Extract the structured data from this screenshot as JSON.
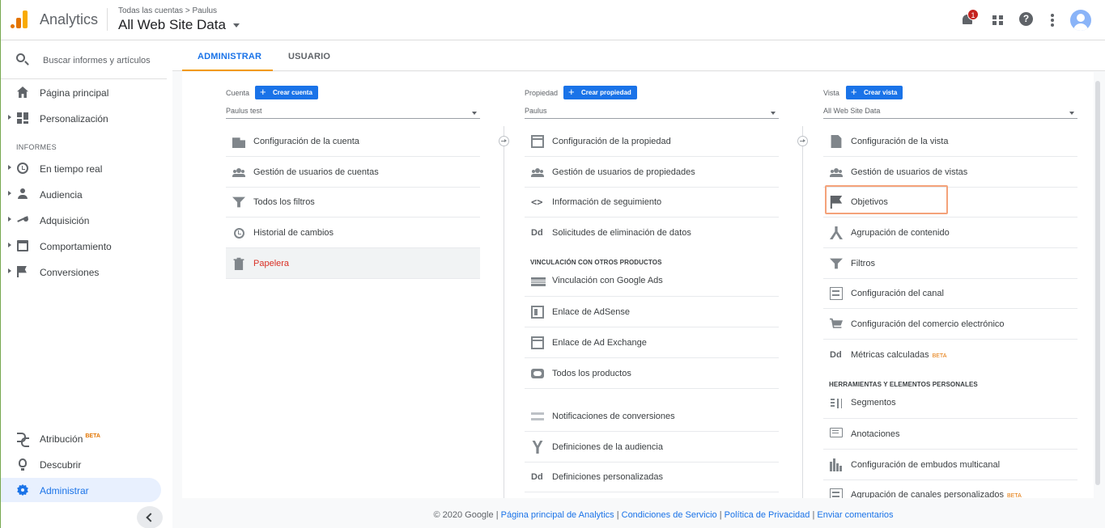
{
  "header": {
    "app_name": "Analytics",
    "breadcrumb": "Todas las cuentas > Paulus",
    "view_title": "All Web Site Data",
    "notification_count": "1"
  },
  "sidebar": {
    "search_placeholder": "Buscar informes y artículos",
    "home": "Página principal",
    "customization": "Personalización",
    "reports_label": "INFORMES",
    "reports": [
      "En tiempo real",
      "Audiencia",
      "Adquisición",
      "Comportamiento",
      "Conversiones"
    ],
    "attribution": "Atribución",
    "attribution_badge": "BETA",
    "discover": "Descubrir",
    "admin": "Administrar"
  },
  "tabs": {
    "admin": "ADMINISTRAR",
    "user": "USUARIO"
  },
  "account_col": {
    "label": "Cuenta",
    "create": "Crear cuenta",
    "selected": "Paulus test",
    "items": [
      "Configuración de la cuenta",
      "Gestión de usuarios de cuentas",
      "Todos los filtros",
      "Historial de cambios",
      "Papelera"
    ]
  },
  "property_col": {
    "label": "Propiedad",
    "create": "Crear propiedad",
    "selected": "Paulus",
    "items": [
      "Configuración de la propiedad",
      "Gestión de usuarios de propiedades",
      "Información de seguimiento",
      "Solicitudes de eliminación de datos"
    ],
    "linking_heading": "VINCULACIÓN CON OTROS PRODUCTOS",
    "linking_items": [
      "Vinculación con Google Ads",
      "Enlace de AdSense",
      "Enlace de Ad Exchange",
      "Todos los productos"
    ],
    "more_items": [
      "Notificaciones de conversiones",
      "Definiciones de la audiencia",
      "Definiciones personalizadas"
    ]
  },
  "view_col": {
    "label": "Vista",
    "create": "Crear vista",
    "selected": "All Web Site Data",
    "items": [
      "Configuración de la vista",
      "Gestión de usuarios de vistas",
      "Objetivos",
      "Agrupación de contenido",
      "Filtros",
      "Configuración del canal",
      "Configuración del comercio electrónico",
      "Métricas calculadas"
    ],
    "beta": "BETA",
    "tools_heading": "HERRAMIENTAS Y ELEMENTOS PERSONALES",
    "tools_items": [
      "Segmentos",
      "Anotaciones",
      "Configuración de embudos multicanal",
      "Agrupación de canales personalizados"
    ]
  },
  "footer": {
    "copyright": "© 2020 Google",
    "sep": "|",
    "links": [
      "Página principal de Analytics",
      "Condiciones de Servicio",
      "Política de Privacidad",
      "Enviar comentarios"
    ]
  },
  "colors": {
    "accent": "#1a73e8",
    "tab_underline": "#f29900",
    "trash": "#d93025",
    "highlight": "#f4a27a"
  }
}
